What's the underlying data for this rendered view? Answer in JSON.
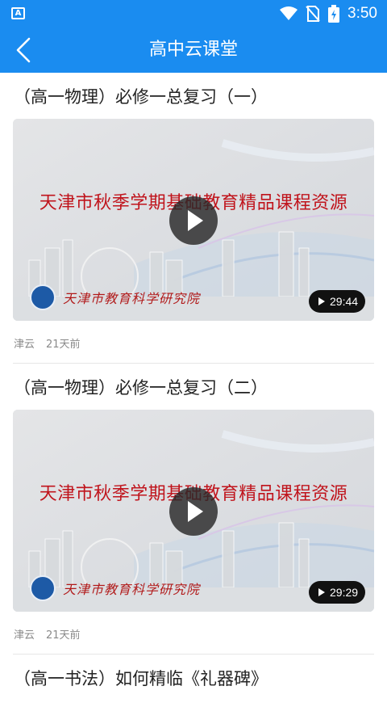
{
  "status_bar": {
    "app_badge": "A",
    "time": "3:50"
  },
  "header": {
    "title": "高中云课堂"
  },
  "videos": [
    {
      "title": "（高一物理）必修一总复习（一）",
      "banner": "天津市秋季学期基础教育精品课程资源",
      "institute": "天津市教育科学研究院",
      "duration": "29:44",
      "source": "津云",
      "posted": "21天前"
    },
    {
      "title": "（高一物理）必修一总复习（二）",
      "banner": "天津市秋季学期基础教育精品课程资源",
      "institute": "天津市教育科学研究院",
      "duration": "29:29",
      "source": "津云",
      "posted": "21天前"
    },
    {
      "title": "（高一书法）如何精临《礼器碑》"
    }
  ],
  "colors": {
    "primary": "#1a8cf0",
    "banner_text": "#c0141c",
    "meta_text": "#8a8a8a"
  }
}
